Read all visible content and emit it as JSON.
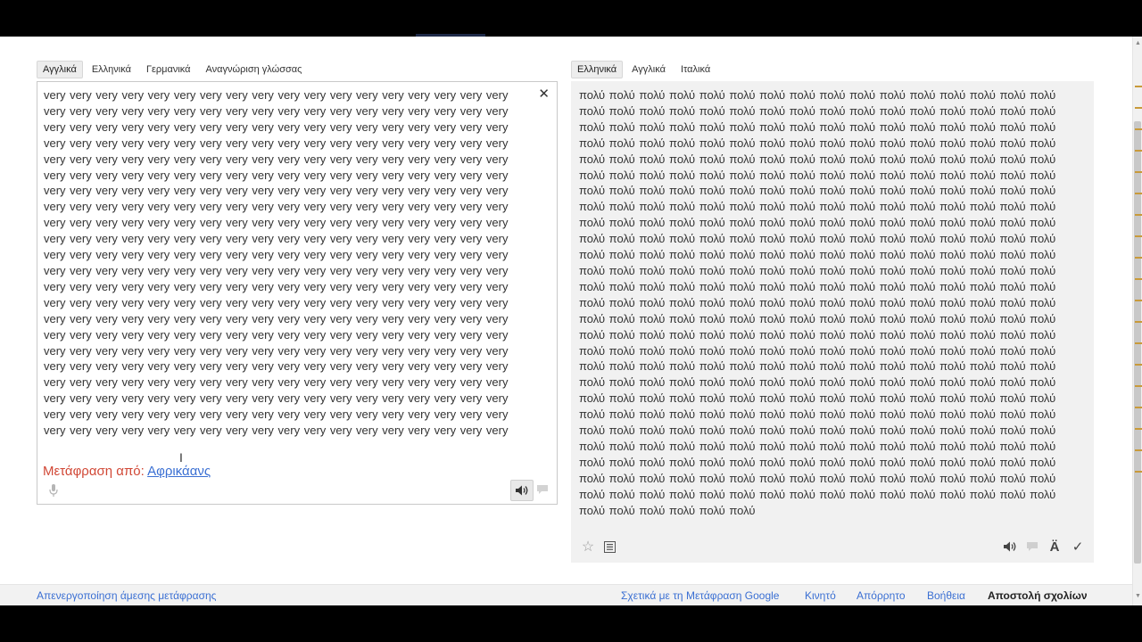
{
  "source_tabs": [
    {
      "label": "Αγγλικά",
      "selected": true
    },
    {
      "label": "Ελληνικά",
      "selected": false
    },
    {
      "label": "Γερμανικά",
      "selected": false
    },
    {
      "label": "Αναγνώριση γλώσσας",
      "selected": false
    }
  ],
  "target_tabs": [
    {
      "label": "Ελληνικά",
      "selected": true
    },
    {
      "label": "Αγγλικά",
      "selected": false
    },
    {
      "label": "Ιταλικά",
      "selected": false
    }
  ],
  "source": {
    "word": "very",
    "word_count": 396,
    "detected_label": "Μετάφραση από:",
    "detected_language": "Αφρικάανς"
  },
  "target": {
    "word": "πολύ",
    "word_count": 422
  },
  "icons": {
    "clear": "close-icon",
    "mic": "microphone-icon",
    "source_listen": "speaker-icon",
    "source_feedback": "comment-icon",
    "star": "star-icon",
    "phrasebook": "list-icon",
    "target_listen": "speaker-icon",
    "target_feedback": "comment-icon",
    "romanize": "A-umlaut-icon",
    "check": "check-icon"
  },
  "icon_glyphs": {
    "romanize": "Ä"
  },
  "footer": {
    "left_link": "Απενεργοποίηση άμεσης μετάφρασης",
    "about": "Σχετικά με τη Μετάφραση Google",
    "mobile": "Κινητό",
    "privacy": "Απόρρητο",
    "help": "Βοήθεια",
    "feedback": "Αποστολή σχολίων"
  },
  "colors": {
    "link": "#3a6fd3",
    "detected_text": "#d14836",
    "target_bg": "#f1f1f1"
  }
}
